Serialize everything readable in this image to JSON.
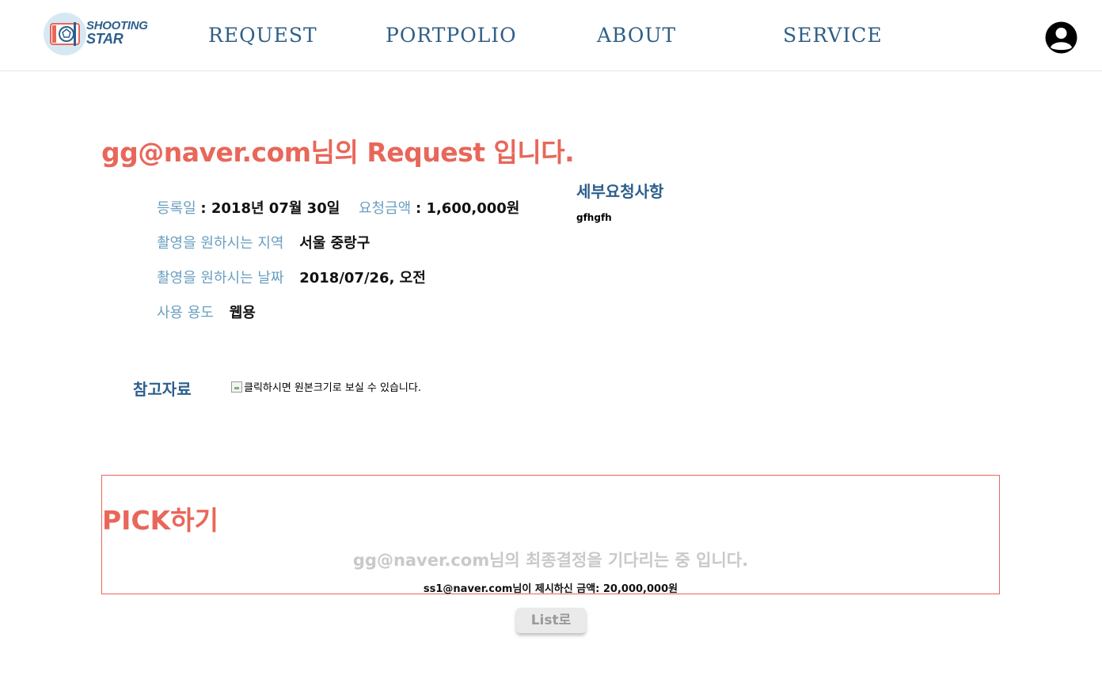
{
  "header": {
    "logo_line1": "SHOOTING",
    "logo_line2": "STAR",
    "nav": [
      "REQUEST",
      "PORTPOLIO",
      "ABOUT",
      "SERVICE"
    ]
  },
  "request": {
    "title": "gg@naver.com님의 Request 입니다.",
    "reg_date_label": "등록일",
    "reg_date_value": ": 2018년 07월 30일",
    "amount_label": "요청금액",
    "amount_value": ": 1,600,000원",
    "region_label": "촬영을 원하시는 지역",
    "region_value": "서울 중랑구",
    "date_label": "촬영을 원하시는 날짜",
    "date_value": "2018/07/26, 오전",
    "usage_label": "사용 용도",
    "usage_value": "웹용",
    "detail_label": "세부요청사항",
    "detail_value": "gfhgfh",
    "ref_label": "참고자료",
    "ref_image_alt": "클릭하시면 원본크기로 보실 수 있습니다."
  },
  "pick": {
    "title": "PICK하기",
    "waiting_text": "gg@naver.com님의 최종결정을 기다리는 중 입니다.",
    "offer_text": "ss1@naver.com님이 제시하신 금액: 20,000,000원"
  },
  "buttons": {
    "list": "List로"
  },
  "colors": {
    "accent": "#e8675a",
    "navy": "#2d5f8c",
    "label_blue": "#6a9fc0"
  }
}
